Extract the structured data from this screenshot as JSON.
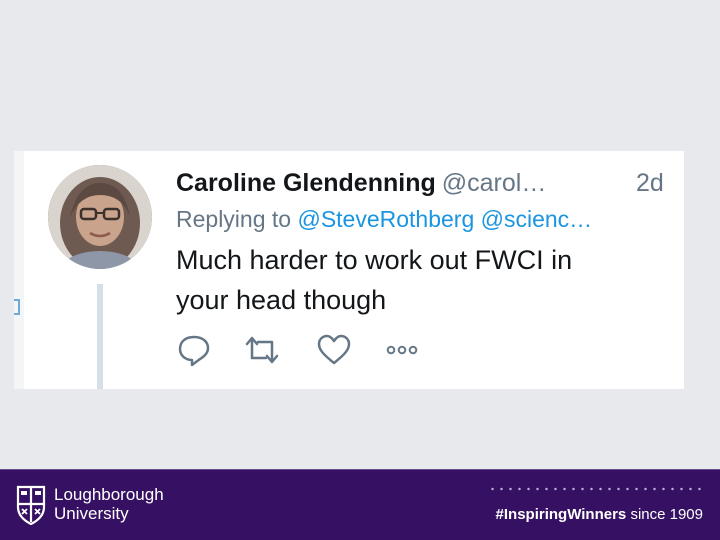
{
  "tweet": {
    "author_name": "Caroline Glendenning",
    "author_handle": "@carol…",
    "timestamp": "2d",
    "replying_prefix": "Replying to",
    "reply_mentions": [
      "@SteveRothberg",
      "@scienc…"
    ],
    "text_lines": [
      "Much harder to work out FWCI in",
      "your head though"
    ],
    "actions": [
      {
        "name": "reply",
        "icon": "reply-icon"
      },
      {
        "name": "retweet",
        "icon": "retweet-icon"
      },
      {
        "name": "like",
        "icon": "heart-icon"
      },
      {
        "name": "more",
        "icon": "more-icon"
      }
    ]
  },
  "footer": {
    "university_lines": [
      "Loughborough",
      "University"
    ],
    "hashtag": "#InspiringWinners",
    "since": "since 1909",
    "crest_icon": "university-crest-icon"
  },
  "colors": {
    "background": "#e8e9ec",
    "footer": "#361163",
    "mention": "#1b95e0",
    "secondary_text": "#657786",
    "primary_text": "#14171a"
  }
}
